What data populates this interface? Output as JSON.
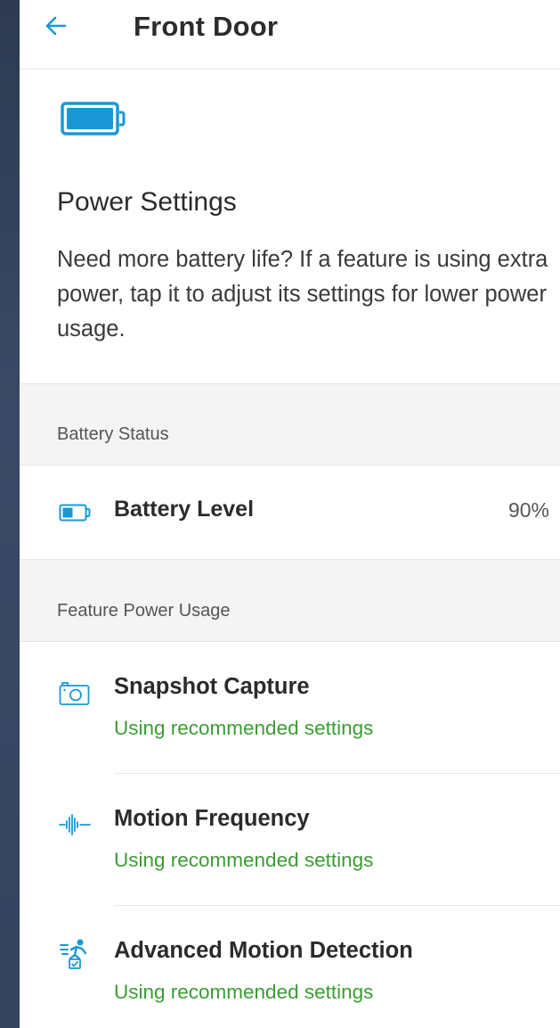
{
  "header": {
    "title": "Front Door",
    "back_icon": "arrow-left-icon"
  },
  "intro": {
    "icon": "battery-icon",
    "title": "Power Settings",
    "description": "Need more battery life? If a feature is using extra power, tap it to adjust its settings for lower power usage."
  },
  "battery_status": {
    "section_label": "Battery Status",
    "level_label": "Battery Level",
    "level_value": "90%",
    "level_fraction": 0.9,
    "icon": "battery-icon"
  },
  "feature_power": {
    "section_label": "Feature Power Usage",
    "items": [
      {
        "title": "Snapshot Capture",
        "status": "Using recommended settings",
        "icon": "camera-icon"
      },
      {
        "title": "Motion Frequency",
        "status": "Using recommended settings",
        "icon": "waveform-icon"
      },
      {
        "title": "Advanced Motion Detection",
        "status": "Using recommended settings",
        "icon": "motion-detection-icon"
      }
    ]
  },
  "colors": {
    "accent": "#1a98d5",
    "status_green": "#3d9b35",
    "backdrop": "#34435e"
  }
}
